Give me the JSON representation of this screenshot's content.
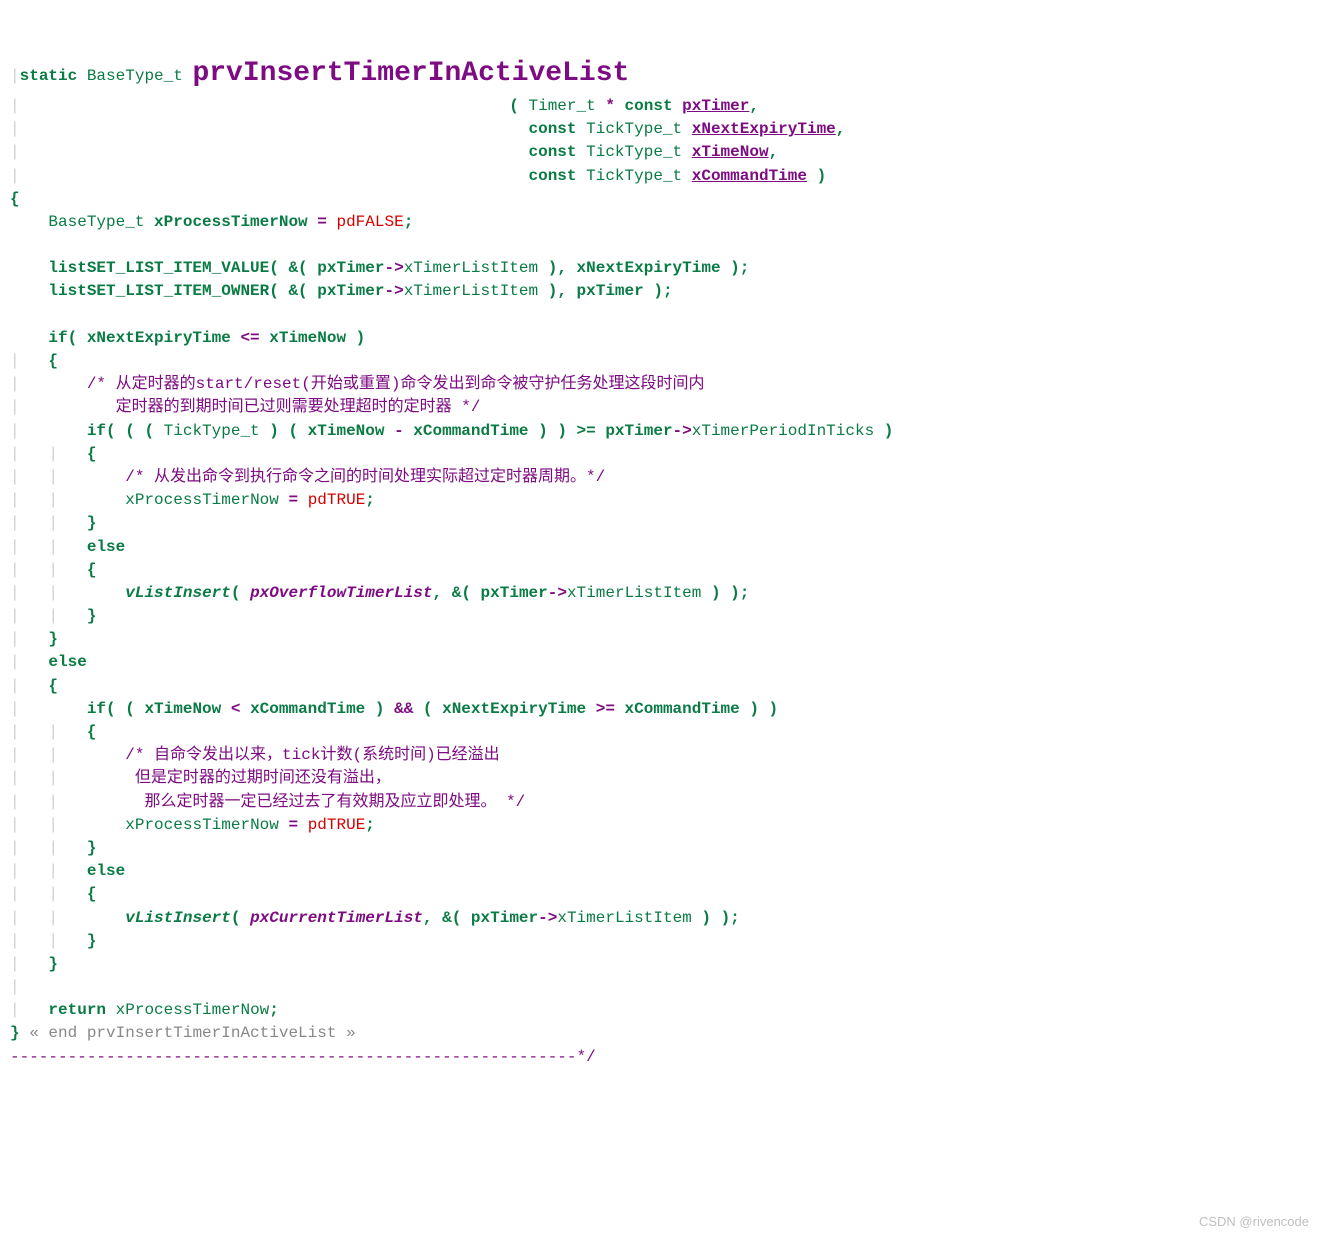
{
  "sig": {
    "static": "static",
    "ret": "BaseType_t",
    "name": "prvInsertTimerInActiveList",
    "p_open": "( ",
    "p_type_timer": "Timer_t",
    "p_star": " * ",
    "p_const": "const",
    "p1": "pxTimer",
    "p_comma": ",",
    "p_type_tick": "TickType_t",
    "p2": "xNextExpiryTime",
    "p3": "xTimeNow",
    "p4": "xCommandTime",
    "p_close": " )"
  },
  "b": {
    "open": "{",
    "close": "}",
    "decl_type": "BaseType_t",
    "decl_var": "xProcessTimerNow",
    "eq": " = ",
    "pdfalse": "pdFALSE",
    "pdtrue": "pdTRUE",
    "semi": ";",
    "set_val": "listSET_LIST_ITEM_VALUE",
    "set_own": "listSET_LIST_ITEM_OWNER",
    "amp_open": "( &( ",
    "pxTimer": "pxTimer",
    "arrow": "->",
    "xTimerListItem": "xTimerListItem",
    "cval_close1": " ), ",
    "xNextExpiryTime": "xNextExpiryTime",
    "call_close": " );",
    "if": "if",
    "else": "else",
    "lte": " <= ",
    "xTimeNow": "xTimeNow",
    "cond1_open": "( ",
    "cond1_close": " )",
    "c1": "/* 从定时器的start/reset(开始或重置)命令发出到命令被守护任务处理这段时间内",
    "c1b": "   定时器的到期时间已过则需要处理超时的定时器 */",
    "cast_open": "( ( ( ",
    "ticktype": "TickType_t",
    "cast_mid": " ) ( ",
    "minus": " - ",
    "xCommandTime": "xCommandTime",
    "cast_close": " ) ) >= ",
    "period": "xTimerPeriodInTicks",
    "cond2_close": " )",
    "c2": "/* 从发出命令到执行命令之间的时间处理实际超过定时器周期。*/",
    "vListInsert": "vListInsert",
    "pxOverflowTimerList": "pxOverflowTimerList",
    "pxCurrentTimerList": "pxCurrentTimerList",
    "ins_mid": ", &( ",
    "ins_close": " ) );",
    "lt": " < ",
    "andand": " && ",
    "gte": " >= ",
    "c3a": "/* 自命令发出以来，tick计数(系统时间)已经溢出",
    "c3b": " 但是定时器的过期时间还没有溢出，",
    "c3c": "  那么定时器一定已经过去了有效期及应立即处理。 */",
    "return": "return",
    "fold": " « end prvInsertTimerInActiveList »",
    "dashline": "-----------------------------------------------------------*/"
  },
  "wm": "CSDN @rivencode"
}
